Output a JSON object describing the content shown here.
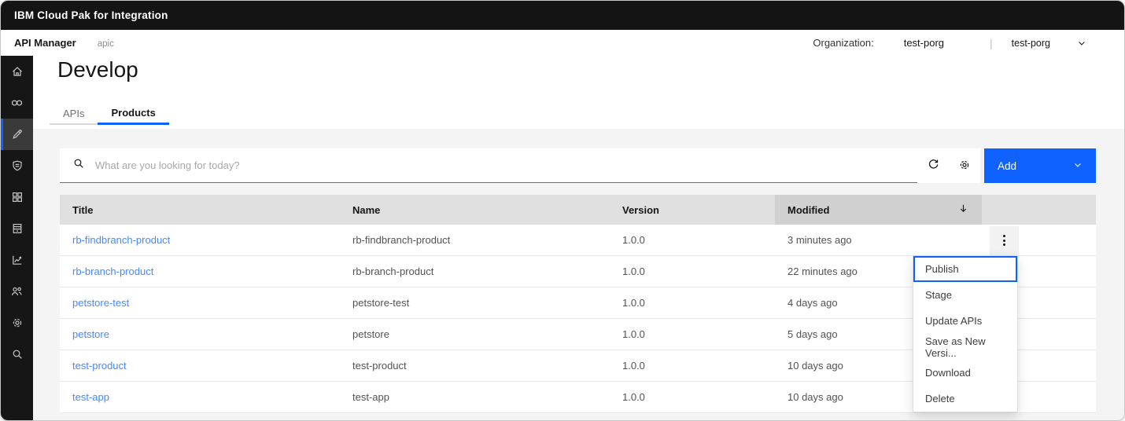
{
  "colors": {
    "accent": "#0f62fe",
    "link": "#4589ff",
    "chrome_bg": "#161616",
    "header_row_bg": "#e0e0e0",
    "sorted_col_bg": "#d0d0d0",
    "page_bg": "#f4f4f4"
  },
  "titlebar": {
    "product": "IBM Cloud Pak for Integration"
  },
  "appbar": {
    "app_name": "API Manager",
    "instance": "apic",
    "organization_label": "Organization:",
    "organization_name": "test-porg",
    "divider": "|",
    "org_selector_value": "test-porg"
  },
  "sidebar": {
    "active_item": "develop",
    "icons": [
      "home",
      "discover",
      "develop",
      "policies",
      "apps",
      "catalog",
      "analytics",
      "members",
      "settings",
      "search"
    ]
  },
  "page": {
    "title": "Develop"
  },
  "tabs": [
    {
      "label": "APIs",
      "active": false
    },
    {
      "label": "Products",
      "active": true
    }
  ],
  "toolbar": {
    "search_placeholder": "What are you looking for today?",
    "add_label": "Add"
  },
  "table": {
    "columns": [
      "Title",
      "Name",
      "Version",
      "Modified"
    ],
    "sort": {
      "column": "Modified",
      "direction": "desc"
    },
    "rows": [
      {
        "title": "rb-findbranch-product",
        "name": "rb-findbranch-product",
        "version": "1.0.0",
        "modified": "3 minutes ago"
      },
      {
        "title": "rb-branch-product",
        "name": "rb-branch-product",
        "version": "1.0.0",
        "modified": "22 minutes ago"
      },
      {
        "title": "petstore-test",
        "name": "petstore-test",
        "version": "1.0.0",
        "modified": "4 days ago"
      },
      {
        "title": "petstore",
        "name": "petstore",
        "version": "1.0.0",
        "modified": "5 days ago"
      },
      {
        "title": "test-product",
        "name": "test-product",
        "version": "1.0.0",
        "modified": "10 days ago"
      },
      {
        "title": "test-app",
        "name": "test-app",
        "version": "1.0.0",
        "modified": "10 days ago"
      }
    ]
  },
  "context_menu": {
    "focused_item": "Publish",
    "items": [
      "Publish",
      "Stage",
      "Update APIs",
      "Save as New Versi...",
      "Download",
      "Delete"
    ]
  }
}
